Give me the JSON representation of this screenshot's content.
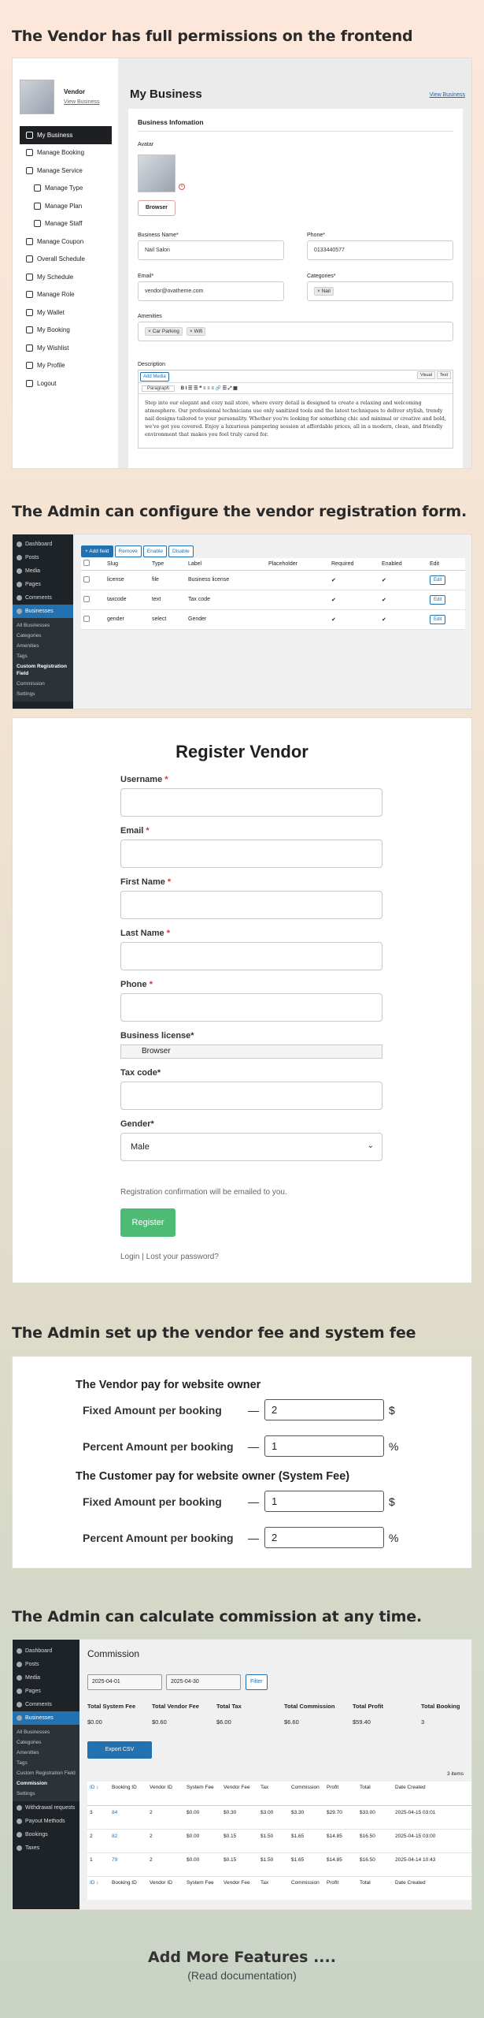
{
  "headings": {
    "s1": "The Vendor has full permissions on the frontend",
    "s2": "The Admin can configure the vendor registration form.",
    "s4": "The Admin set up the vendor fee and system fee",
    "s5": "The Admin can calculate commission at any time."
  },
  "vendor_panel": {
    "name": "Vendor",
    "view_business": "View Business",
    "menu": [
      {
        "label": "My Business",
        "icon": "home-icon",
        "sub": false,
        "active": true
      },
      {
        "label": "Manage Booking",
        "icon": "calendar-icon",
        "sub": false
      },
      {
        "label": "Manage Service",
        "icon": "grid-icon",
        "sub": false
      },
      {
        "label": "Manage Type",
        "icon": "folder-icon",
        "sub": true
      },
      {
        "label": "Manage Plan",
        "icon": "folder-icon",
        "sub": true
      },
      {
        "label": "Manage Staff",
        "icon": "people-icon",
        "sub": true
      },
      {
        "label": "Manage Coupon",
        "icon": "coupon-icon",
        "sub": false
      },
      {
        "label": "Overall Schedule",
        "icon": "schedule-icon",
        "sub": false
      },
      {
        "label": "My Schedule",
        "icon": "calendar-icon",
        "sub": false
      },
      {
        "label": "Manage Role",
        "icon": "key-icon",
        "sub": false
      },
      {
        "label": "My Wallet",
        "icon": "wallet-icon",
        "sub": false
      },
      {
        "label": "My Booking",
        "icon": "booking-icon",
        "sub": false
      },
      {
        "label": "My Wishlist",
        "icon": "heart-icon",
        "sub": false
      },
      {
        "label": "My Profile",
        "icon": "user-icon",
        "sub": false
      },
      {
        "label": "Logout",
        "icon": "logout-icon",
        "sub": false
      }
    ],
    "title": "My Business",
    "view_business_link": "View Business",
    "section_title": "Business Infomation",
    "avatar_label": "Avatar",
    "browser_btn": "Browser",
    "business_name_label": "Business Name*",
    "business_name_value": "Nail Salon",
    "phone_label": "Phone*",
    "phone_value": "0133440577",
    "email_label": "Email*",
    "email_value": "vendor@ovatheme.com",
    "categories_label": "Categories*",
    "category_tag": "× Nail",
    "amenities_label": "Amenities",
    "amenity_tags": [
      "× Car Parking",
      "× Wifi"
    ],
    "description_label": "Description",
    "add_media": "Add Media",
    "visual": "Visual",
    "text": "Text",
    "paragraph": "Paragraph",
    "toolbar": "B  I  ☰  ☰  ❝  ≡  ≡  ≡  🔗  ☰  ⤢  ▦",
    "description": "Step into our elegant and cozy nail store, where every detail is designed to create a relaxing and welcoming atmosphere. Our professional technicians use only sanitized tools and the latest techniques to deliver stylish, trendy nail designs tailored to your personality. Whether you're looking for something chic and minimal or creative and bold, we've got you covered. Enjoy a luxurious pampering session at affordable prices, all in a modern, clean, and friendly environment that makes you feel truly cared for."
  },
  "admin_menu": [
    "Dashboard",
    "Posts",
    "Media",
    "Pages",
    "Comments",
    "Businesses"
  ],
  "admin_sub": [
    "All Businesses",
    "Categories",
    "Amenities",
    "Tags",
    "Custom Registration Field",
    "Commission",
    "Settings"
  ],
  "reg_fields": {
    "buttons": [
      "+ Add field",
      "Remove",
      "Enable",
      "Disable"
    ],
    "columns": [
      "Slug",
      "Type",
      "Label",
      "Placeholder",
      "Required",
      "Enabled",
      "Edit"
    ],
    "rows": [
      {
        "slug": "license",
        "type": "file",
        "label": "Business license",
        "placeholder": "",
        "required": "✔",
        "enabled": "✔",
        "edit": "Edit"
      },
      {
        "slug": "taxcode",
        "type": "text",
        "label": "Tax code",
        "placeholder": "",
        "required": "✔",
        "enabled": "✔",
        "edit": "Edit"
      },
      {
        "slug": "gender",
        "type": "select",
        "label": "Gender",
        "placeholder": "",
        "required": "✔",
        "enabled": "✔",
        "edit": "Edit"
      }
    ]
  },
  "register": {
    "title": "Register Vendor",
    "username": "Username",
    "email": "Email",
    "first_name": "First Name",
    "last_name": "Last Name",
    "phone": "Phone",
    "star": "*",
    "license": "Business license*",
    "browser": "Browser",
    "tax": "Tax code*",
    "gender": "Gender*",
    "gender_value": "Male",
    "note": "Registration confirmation will be emailed to you.",
    "button": "Register",
    "login": "Login",
    "sep": "|",
    "lost": "Lost your password?"
  },
  "fees": {
    "vendor_title": "The Vendor pay for website owner",
    "customer_title": "The Customer pay for website owner (System Fee)",
    "fixed_label": "Fixed Amount per booking",
    "percent_label": "Percent Amount per booking",
    "dash": "—",
    "vendor_fixed": "2",
    "vendor_percent": "1",
    "customer_fixed": "1",
    "customer_percent": "2",
    "currency": "$",
    "percent": "%"
  },
  "commission": {
    "menu": [
      "Dashboard",
      "Posts",
      "Media",
      "Pages",
      "Comments",
      "Businesses"
    ],
    "sub": [
      "All Businesses",
      "Categories",
      "Amenities",
      "Tags",
      "Custom Registration Field",
      "Commission",
      "Settings"
    ],
    "menu2": [
      "Withdrawal requests",
      "Payout Methods",
      "Bookings",
      "Taxes"
    ],
    "title": "Commission",
    "date_from": "2025-04-01",
    "date_to": "2025-04-30",
    "filter": "Filter",
    "totals": [
      {
        "label": "Total System Fee",
        "value": "$0.00"
      },
      {
        "label": "Total Vendor Fee",
        "value": "$0.60"
      },
      {
        "label": "Total Tax",
        "value": "$6.00"
      },
      {
        "label": "Total Commission",
        "value": "$6.60"
      },
      {
        "label": "Total Profit",
        "value": "$59.40"
      },
      {
        "label": "Total Booking",
        "value": "3"
      }
    ],
    "export": "Export CSV",
    "items": "3 items",
    "columns": [
      "ID ↕",
      "Booking ID",
      "Vendor ID",
      "System Fee",
      "Vendor Fee",
      "Tax",
      "Commission",
      "Profit",
      "Total",
      "Date Created"
    ],
    "rows": [
      [
        "3",
        "84",
        "2",
        "$0.00",
        "$0.30",
        "$3.00",
        "$3.30",
        "$29.70",
        "$33.00",
        "2025-04-15 03:01"
      ],
      [
        "2",
        "82",
        "2",
        "$0.00",
        "$0.15",
        "$1.50",
        "$1.65",
        "$14.85",
        "$16.50",
        "2025-04-15 03:00"
      ],
      [
        "1",
        "79",
        "2",
        "$0.00",
        "$0.15",
        "$1.50",
        "$1.65",
        "$14.85",
        "$16.50",
        "2025-04-14 10:43"
      ]
    ]
  },
  "footer": {
    "title": "Add More Features ....",
    "sub": "(Read documentation)"
  }
}
